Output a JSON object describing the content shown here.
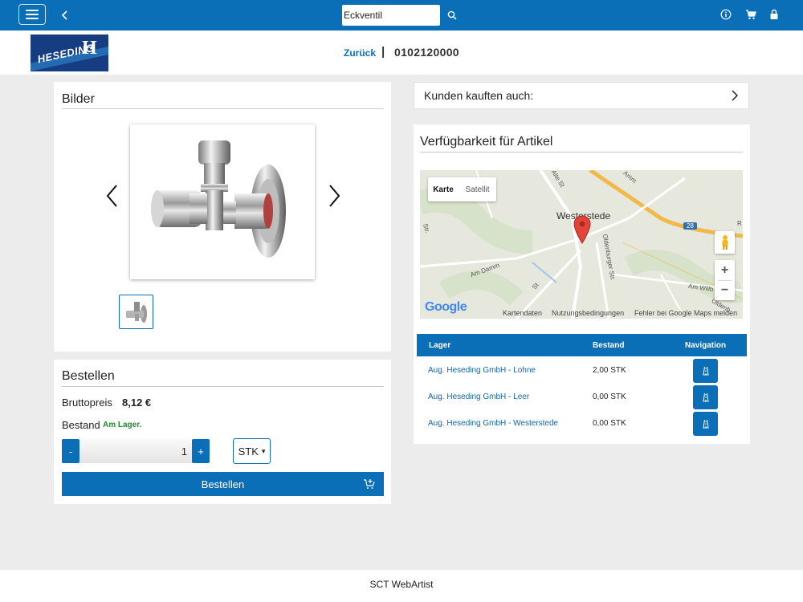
{
  "topbar": {
    "search_value": "Eckventil"
  },
  "header": {
    "logo_text": "HESEDING",
    "logo_mark": "H",
    "back_label": "Zurück",
    "separator": "|",
    "article_number": "0102120000"
  },
  "images_panel": {
    "title": "Bilder"
  },
  "order_panel": {
    "title": "Bestellen",
    "price_label": "Bruttopreis",
    "price_value": "8,12 €",
    "stock_label": "Bestand",
    "stock_value": "Am Lager.",
    "minus_label": "-",
    "plus_label": "+",
    "quantity": "1",
    "unit": "STK",
    "unit_caret": "▾",
    "order_button": "Bestellen"
  },
  "customers_also_bought": {
    "title": "Kunden kauften auch:"
  },
  "availability": {
    "title": "Verfügbarkeit für Artikel",
    "map": {
      "tab_map": "Karte",
      "tab_satellite": "Satellit",
      "city": "Westerstede",
      "road_badge": "28",
      "zoom_in": "+",
      "zoom_out": "−",
      "google": "Google",
      "footer_data": "Kartendaten",
      "footer_terms": "Nutzungsbedingungen",
      "footer_report": "Fehler bei Google Maps melden",
      "street_labels": [
        "Am Damm",
        "Oldenburger Str.",
        "Am Willb",
        "Alte St",
        "Amm",
        "Str.",
        "Oldenb",
        "R",
        "St"
      ]
    },
    "table": {
      "col_store": "Lager",
      "col_stock": "Bestand",
      "col_nav": "Navigation",
      "rows": [
        {
          "store": "Aug. Heseding GmbH - Lohne",
          "stock": "2,00 STK"
        },
        {
          "store": "Aug. Heseding GmbH - Leer",
          "stock": "0,00 STK"
        },
        {
          "store": "Aug. Heseding GmbH - Westerstede",
          "stock": "0,00 STK"
        }
      ]
    }
  },
  "footer": {
    "text": "SCT WebArtist"
  },
  "colors": {
    "brand_blue": "#0b6fb8",
    "stock_green": "#1f8b2c",
    "page_bg": "#ececec"
  }
}
